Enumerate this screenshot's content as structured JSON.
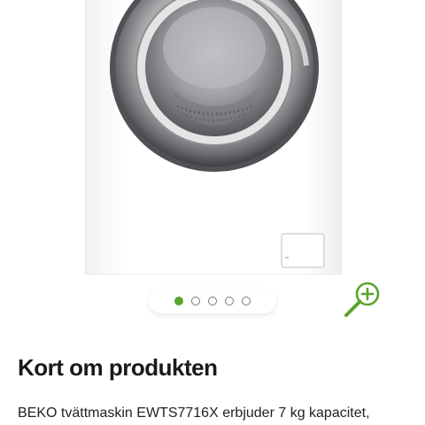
{
  "gallery": {
    "image_alt": "BEKO tvättmaskin EWTS7716X",
    "slide_count": 5,
    "active_slide": 1,
    "accent_color": "#5aa52a",
    "zoom_icon": "zoom-in-icon"
  },
  "product_summary": {
    "title": "Kort om produkten",
    "text": "BEKO tvättmaskin EWTS7716X erbjuder 7 kg kapacitet,"
  }
}
